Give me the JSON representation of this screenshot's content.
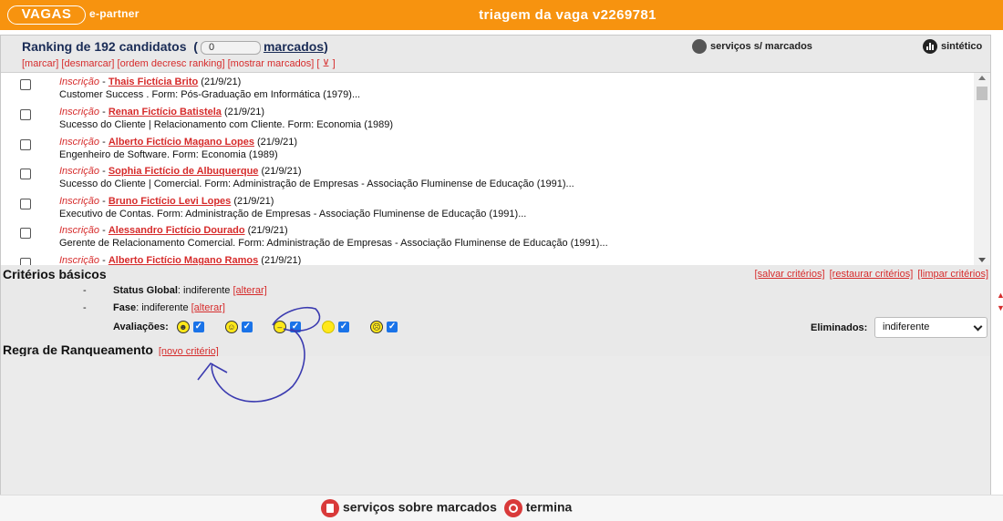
{
  "header": {
    "logo_text": "VAGAS",
    "logo_sub": "e-partner",
    "title": "triagem da vaga v2269781"
  },
  "ranking": {
    "title_prefix": "Ranking de 192 candidatos",
    "marked_count": "0",
    "marked_label": "marcados",
    "actions": [
      "[marcar]",
      "[desmarcar]",
      "[ordem decresc ranking]",
      "[mostrar marcados]",
      "[ ⊻ ]"
    ],
    "services_label": "serviços s/ marcados",
    "synthetic_label": "sintético"
  },
  "candidates": [
    {
      "kind": "Inscrição",
      "name": "Thais Fictícia Brito",
      "date": "(21/9/21)",
      "desc": "Customer Success . Form: Pós-Graduação em Informática (1979)..."
    },
    {
      "kind": "Inscrição",
      "name": "Renan Fictício Batistela",
      "date": "(21/9/21)",
      "desc": "Sucesso do Cliente | Relacionamento com Cliente. Form: Economia (1989)"
    },
    {
      "kind": "Inscrição",
      "name": "Alberto Fictício Magano Lopes",
      "date": "(21/9/21)",
      "desc": "Engenheiro de Software. Form: Economia (1989)"
    },
    {
      "kind": "Inscrição",
      "name": "Sophia Fictício de Albuquerque",
      "date": "(21/9/21)",
      "desc": "Sucesso do Cliente | Comercial. Form: Administração de Empresas - Associação Fluminense de Educação (1991)..."
    },
    {
      "kind": "Inscrição",
      "name": "Bruno Fictício Levi Lopes",
      "date": "(21/9/21)",
      "desc": "Executivo de Contas. Form: Administração de Empresas - Associação Fluminense de Educação (1991)..."
    },
    {
      "kind": "Inscrição",
      "name": "Alessandro Fictício Dourado",
      "date": "(21/9/21)",
      "desc": "Gerente de Relacionamento Comercial. Form: Administração de Empresas - Associação Fluminense de Educação (1991)..."
    },
    {
      "kind": "Inscrição",
      "name": "Alberto Fictício Magano Ramos",
      "date": "(21/9/21)",
      "desc": ""
    }
  ],
  "criteria": {
    "title": "Critérios básicos",
    "links": [
      "[salvar critérios]",
      "[restaurar critérios]",
      "[limpar critérios]"
    ],
    "status_label": "Status Global",
    "status_value": ": indiferente",
    "status_link": "[alterar]",
    "fase_label": "Fase",
    "fase_value": ": indiferente",
    "fase_link": "[alterar]",
    "avaliacoes_label": "Avaliações:",
    "eliminados_label": "Eliminados:",
    "eliminados_value": "indiferente"
  },
  "regra": {
    "title": "Regra de Ranqueamento",
    "link": "[novo critério]"
  },
  "footer": {
    "services_label": "serviços sobre marcados",
    "finish_label": "termina"
  },
  "colors": {
    "header": "#f7930f",
    "link": "#d62b2b",
    "checkbox_checked": "#1a73e8",
    "annotation": "#3b3bb0"
  }
}
